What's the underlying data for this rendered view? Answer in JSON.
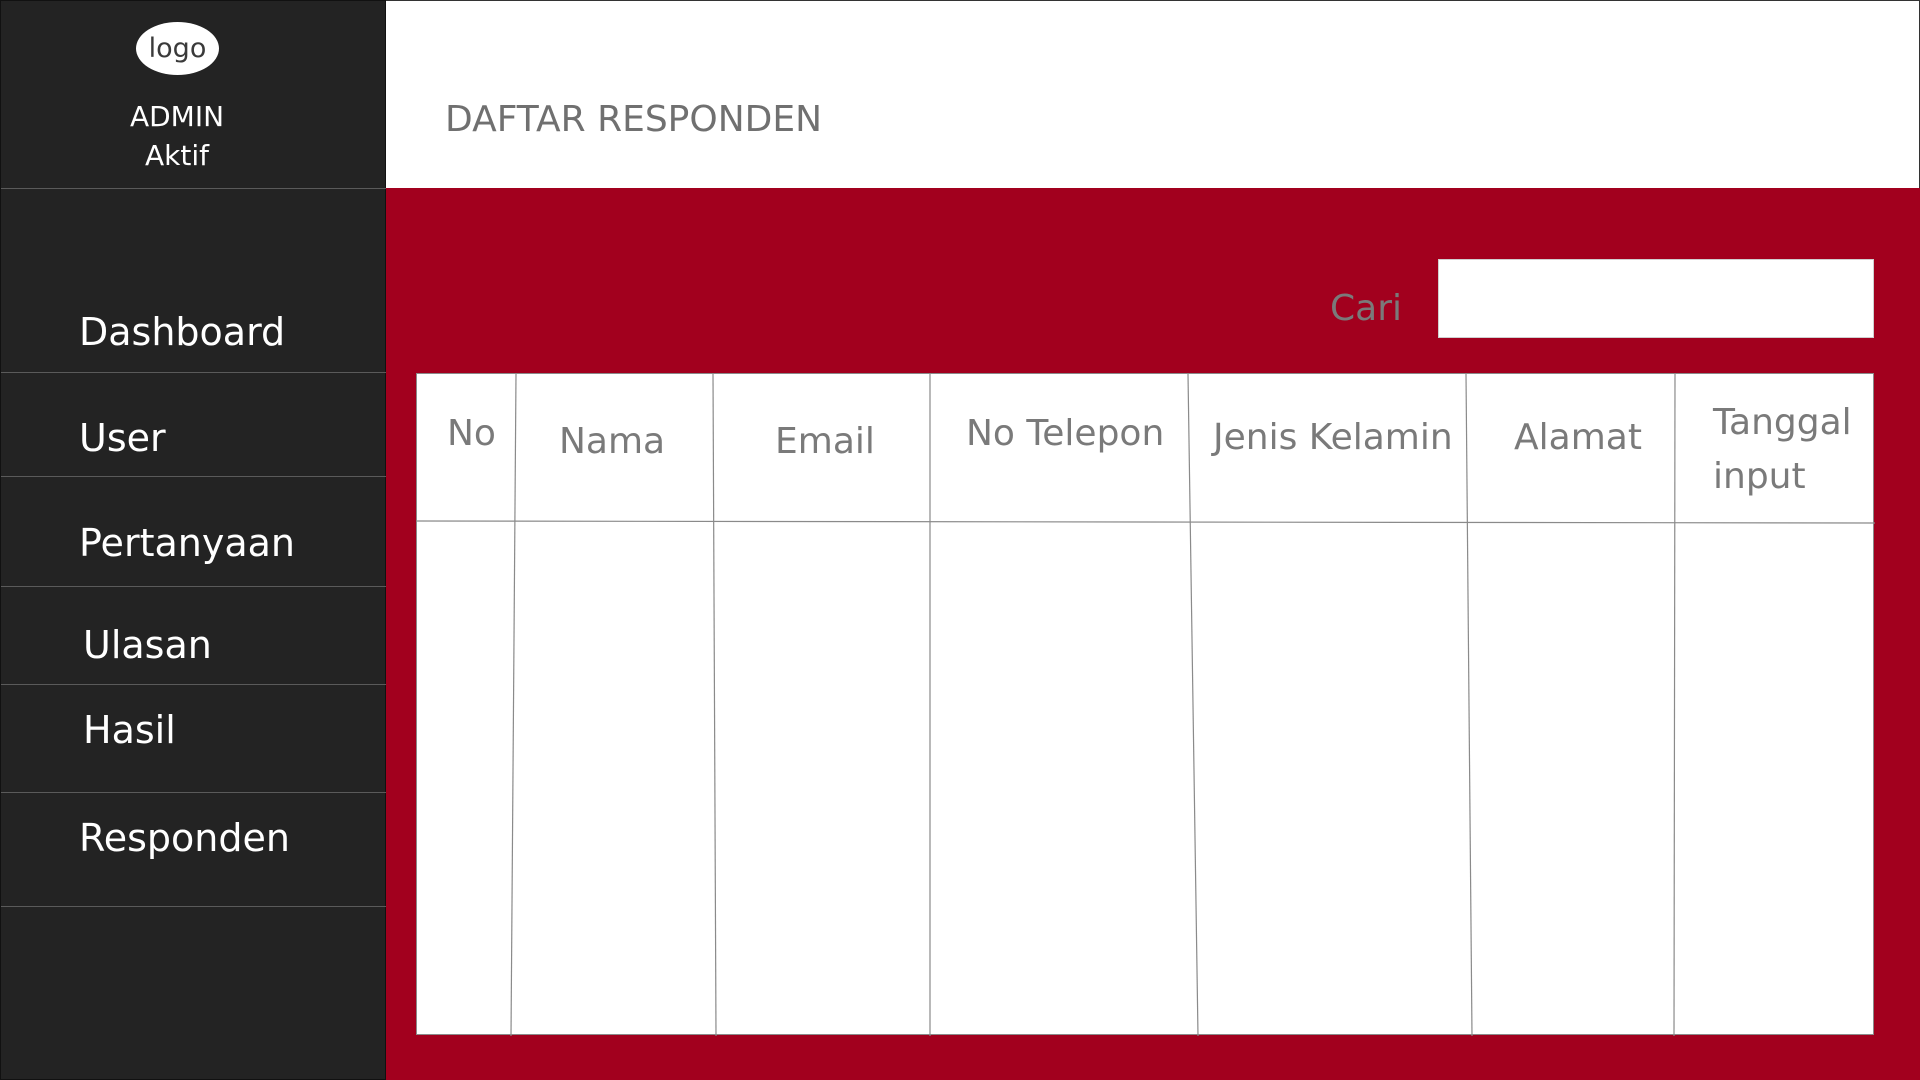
{
  "admin": {
    "logo_text": "logo",
    "name": "ADMIN",
    "status": "Aktif"
  },
  "sidebar": {
    "items": [
      {
        "label": "Dashboard"
      },
      {
        "label": "User"
      },
      {
        "label": "Pertanyaan"
      },
      {
        "label": "Ulasan"
      },
      {
        "label": "Hasil"
      },
      {
        "label": "Responden"
      }
    ]
  },
  "header": {
    "title": "DAFTAR RESPONDEN"
  },
  "search": {
    "label": "Cari",
    "value": "",
    "placeholder": ""
  },
  "table": {
    "columns": [
      "No",
      "Nama",
      "Email",
      "No Telepon",
      "Jenis Kelamin",
      "Alamat",
      "Tanggal input"
    ],
    "rows": []
  },
  "colors": {
    "sidebar_bg": "#232323",
    "main_bg": "#a2001e",
    "text_muted": "#707070"
  }
}
